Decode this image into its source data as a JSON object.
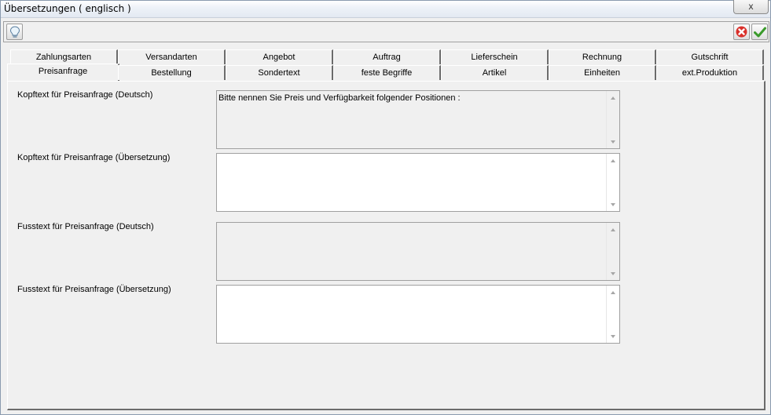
{
  "window": {
    "title": "Übersetzungen ( englisch )",
    "close_glyph": "x"
  },
  "toolbar": {
    "icons": [
      "lightbulb-icon",
      "cancel-icon",
      "checkmark-icon"
    ]
  },
  "tabs": {
    "row1": [
      "Zahlungsarten",
      "Versandarten",
      "Angebot",
      "Auftrag",
      "Lieferschein",
      "Rechnung",
      "Gutschrift"
    ],
    "row2": [
      "Preisanfrage",
      "Bestellung",
      "Sondertext",
      "feste Begriffe",
      "Artikel",
      "Einheiten",
      "ext.Produktion"
    ],
    "active": "Preisanfrage"
  },
  "fields": [
    {
      "label": "Kopftext für Preisanfrage (Deutsch)",
      "value": "Bitte nennen Sie Preis und Verfügbarkeit folgender Positionen :",
      "readonly": true
    },
    {
      "label": "Kopftext für Preisanfrage (Übersetzung)",
      "value": "",
      "readonly": false
    },
    {
      "label": "Fusstext für Preisanfrage (Deutsch)",
      "value": "",
      "readonly": true
    },
    {
      "label": "Fusstext für Preisanfrage (Übersetzung)",
      "value": "",
      "readonly": false
    }
  ],
  "colors": {
    "cancel": "#d9302a",
    "ok": "#3a9a2a"
  }
}
